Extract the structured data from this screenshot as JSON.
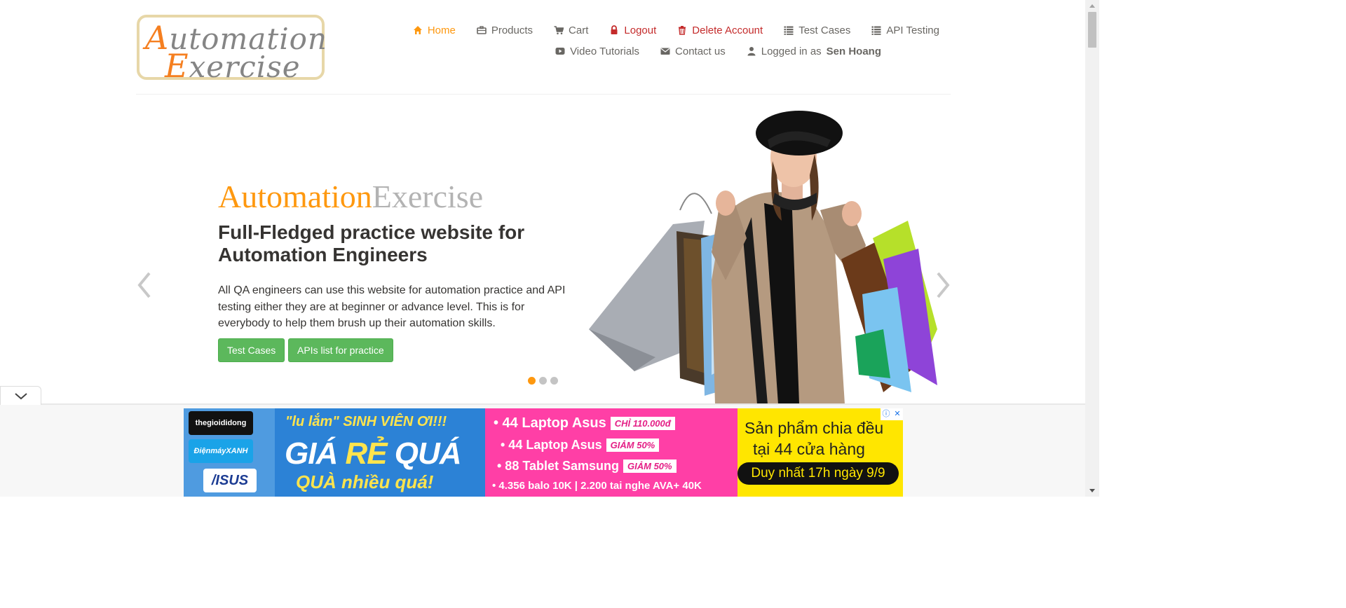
{
  "logo": {
    "line1_cap": "A",
    "line1_rest": "utomation",
    "line2_cap": "E",
    "line2_rest": "xercise"
  },
  "nav": {
    "items": [
      {
        "label": "Home",
        "icon": "home-icon",
        "active": true
      },
      {
        "label": "Products",
        "icon": "briefcase-icon"
      },
      {
        "label": "Cart",
        "icon": "cart-icon"
      },
      {
        "label": "Logout",
        "icon": "lock-icon"
      },
      {
        "label": "Delete Account",
        "icon": "trash-icon"
      },
      {
        "label": "Test Cases",
        "icon": "list-icon"
      },
      {
        "label": "API Testing",
        "icon": "list-icon"
      },
      {
        "label": "Video Tutorials",
        "icon": "youtube-icon"
      },
      {
        "label": "Contact us",
        "icon": "envelope-icon"
      },
      {
        "label": "Logged in as",
        "icon": "user-icon",
        "username": "Sen Hoang"
      }
    ]
  },
  "slider": {
    "title_part1": "Automation",
    "title_part2": "Exercise",
    "heading": "Full-Fledged practice website for Automation Engineers",
    "text": "All QA engineers can use this website for automation practice and API testing either they are at beginner or advance level. This is for everybody to help them brush up their automation skills.",
    "button_test_cases": "Test Cases",
    "button_apis": "APIs list for practice",
    "active_slide": 1,
    "slide_count": 3
  },
  "ad": {
    "brand1": "thegioididong",
    "brand2": "ĐiệnmáyXANH",
    "brand3": "/ISUS",
    "headline1": "\"lu lắm\" SINH VIÊN ƠI!!!",
    "headline2_a": "GIÁ ",
    "headline2_b": "RẺ",
    "headline2_c": " QUÁ",
    "headline3": "QUÀ nhiều quá!",
    "promo1": "• 44 Laptop Asus",
    "promo1_tag": "CHỈ 110.000đ",
    "promo2": "• 44 Laptop Asus",
    "promo2_tag": "GIẢM 50%",
    "promo3": "• 88 Tablet Samsung",
    "promo3_tag": "GIẢM 50%",
    "promo4": "• 4.356 balo 10K | 2.200 tai nghe AVA+ 40K",
    "right1": "Sản phẩm chia đều",
    "right2": "tại 44 cửa hàng",
    "right3": "Duy nhất 17h ngày 9/9",
    "info": "ⓘ",
    "close": "✕"
  },
  "colors": {
    "accent": "#fe980f",
    "button_green": "#5cb85c",
    "danger": "#c42b2b"
  }
}
